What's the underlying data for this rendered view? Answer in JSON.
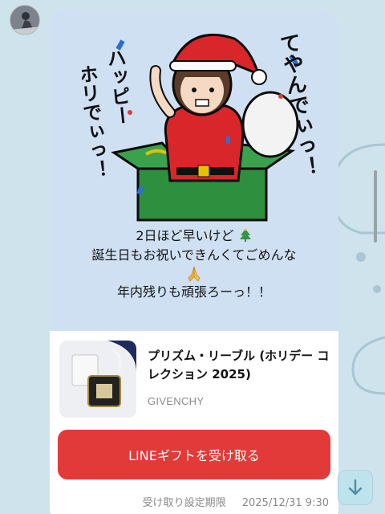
{
  "sticker": {
    "text_right": "てやんでぃっ！",
    "text_left_1": "ハッピー",
    "text_left_2": "ホリでぃっ！"
  },
  "message": {
    "line1": "2日ほど早いけど",
    "line2": "誕生日もお祝いできんくてごめんな",
    "line3": "年内残りも頑張ろーっ！！"
  },
  "product": {
    "name": "プリズム・リーブル (ホリデー コレクション 2025)",
    "brand": "GIVENCHY"
  },
  "cta_label": "LINEギフトを受け取る",
  "deadline": {
    "label": "受け取り設定期限",
    "value": "2025/12/31 9:30"
  },
  "colors": {
    "cta": "#e23a38",
    "card_top": "#cfe0f3",
    "chat_bg": "#cfe3ec"
  },
  "icons": {
    "scroll": "arrow-down-icon",
    "tree": "christmas-tree-icon",
    "pray": "folded-hands-icon"
  }
}
